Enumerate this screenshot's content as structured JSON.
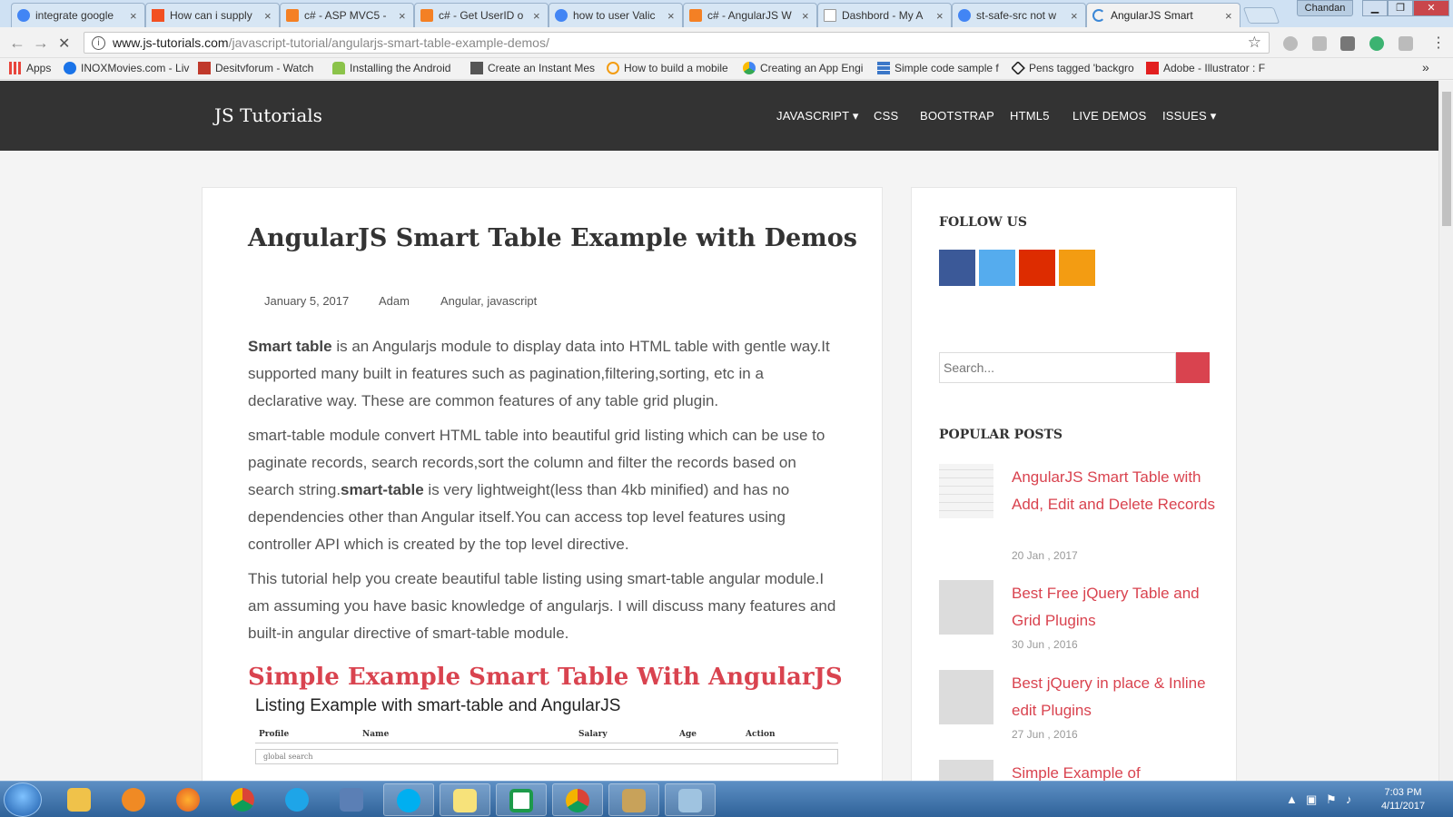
{
  "browser": {
    "tabs": [
      {
        "title": "integrate google",
        "icon": "google-icon",
        "color": "#4285f4"
      },
      {
        "title": "How can i supply",
        "icon": "microsoft-icon",
        "color": "#f25022"
      },
      {
        "title": "c# - ASP MVC5 -",
        "icon": "stackoverflow-icon",
        "color": "#f48024"
      },
      {
        "title": "c# - Get UserID o",
        "icon": "stackoverflow-icon",
        "color": "#f48024"
      },
      {
        "title": "how to user Valic",
        "icon": "google-icon",
        "color": "#4285f4"
      },
      {
        "title": "c# - AngularJS W",
        "icon": "stackoverflow-icon",
        "color": "#f48024"
      },
      {
        "title": "Dashbord - My A",
        "icon": "page-icon",
        "color": "#999999"
      },
      {
        "title": "st-safe-src not w",
        "icon": "google-icon",
        "color": "#4285f4"
      },
      {
        "title": "AngularJS Smart",
        "icon": "loading-icon",
        "color": "#3b87d6"
      }
    ],
    "user_name": "Chandan",
    "url_host": "www.js-tutorials.com",
    "url_path": "/javascript-tutorial/angularjs-smart-table-example-demos/",
    "bookmarks": [
      {
        "label": "Apps",
        "icon": "apps-grid-icon",
        "color": "#e8453c"
      },
      {
        "label": "INOXMovies.com - Liv",
        "icon": "chrome-icon",
        "color": "#1a73e8"
      },
      {
        "label": "Desitvforum - Watch",
        "icon": "desitv-icon",
        "color": "#c0392b"
      },
      {
        "label": "Installing the Android",
        "icon": "android-icon",
        "color": "#8bc34a"
      },
      {
        "label": "Create an Instant Mes",
        "icon": "page-icon",
        "color": "#555555"
      },
      {
        "label": "How to build a mobile",
        "icon": "circle-icon",
        "color": "#f39c12"
      },
      {
        "label": "Creating an App Engi",
        "icon": "appengine-icon",
        "color": "#4285f4"
      },
      {
        "label": "Simple code sample f",
        "icon": "grid-icon",
        "color": "#3b77c8"
      },
      {
        "label": "Pens tagged 'backgro",
        "icon": "codepen-icon",
        "color": "#222222"
      },
      {
        "label": "Adobe - Illustrator : F",
        "icon": "adobe-icon",
        "color": "#e21f1f"
      }
    ]
  },
  "site": {
    "brand": "JS Tutorials",
    "nav": [
      "JAVASCRIPT ▾",
      "CSS",
      "BOOTSTRAP",
      "HTML5",
      "LIVE DEMOS",
      "ISSUES ▾"
    ]
  },
  "article": {
    "title": "AngularJS Smart Table Example with Demos",
    "date": "January 5, 2017",
    "author": "Adam",
    "categories": "Angular, javascript",
    "p1_bold": "Smart table",
    "p1_rest": " is an Angularjs module to display data into HTML table with gentle way.It supported many built in features such as pagination,filtering,sorting, etc in a declarative way. These are common features of any table grid plugin.",
    "p2_start": "smart-table module convert HTML table into beautiful grid listing which can be use to paginate records, search records,sort the column and filter the records based on search string.",
    "p2_bold": "smart-table",
    "p2_rest": " is very lightweight(less than 4kb minified) and has no dependencies other than Angular itself.You can access top level features using controller API which is created by the top level directive.",
    "p3": "This tutorial help you create beautiful table listing using smart-table angular module.I am assuming you have basic knowledge of angularjs. I will discuss many features and built-in angular directive of smart-table module.",
    "section_heading": "Simple Example Smart Table With AngularJS",
    "demo_title": "Listing Example with smart-table and AngularJS",
    "demo_columns": [
      "Profile",
      "Name",
      "Salary",
      "Age",
      "Action"
    ],
    "demo_search_placeholder": "global search"
  },
  "sidebar": {
    "follow_heading": "FOLLOW US",
    "social": [
      {
        "name": "facebook-icon",
        "color": "#3b5998"
      },
      {
        "name": "twitter-icon",
        "color": "#55acee"
      },
      {
        "name": "googleplus-icon",
        "color": "#dd2c00"
      },
      {
        "name": "rss-icon",
        "color": "#f39c12"
      }
    ],
    "search_placeholder": "Search...",
    "popular_heading": "POPULAR POSTS",
    "posts": [
      {
        "title": "AngularJS Smart Table with Add, Edit and Delete Records",
        "date": "20 Jan , 2017"
      },
      {
        "title": "Best Free jQuery Table and Grid Plugins",
        "date": "30 Jun , 2016"
      },
      {
        "title": "Best jQuery in place & Inline edit Plugins",
        "date": "27 Jun , 2016"
      },
      {
        "title": "Simple Example of",
        "date": ""
      }
    ]
  },
  "taskbar": {
    "time": "7:03 PM",
    "date": "4/11/2017"
  },
  "colors": {
    "accent": "#d9434f",
    "header_bg": "#333333"
  }
}
